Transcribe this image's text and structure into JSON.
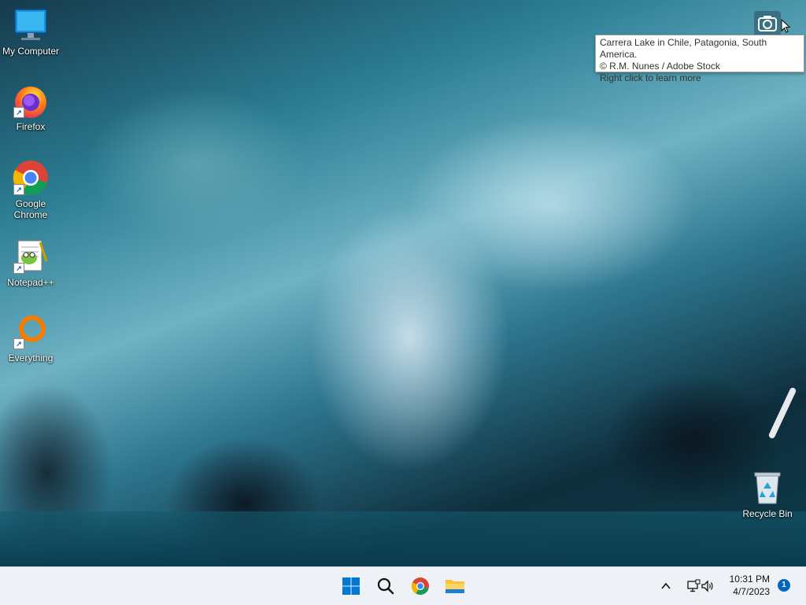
{
  "desktop": {
    "icons": [
      {
        "label": "My Computer",
        "icon": "monitor-icon"
      },
      {
        "label": "Firefox",
        "icon": "firefox-icon"
      },
      {
        "label": "Google\nChrome",
        "icon": "chrome-icon"
      },
      {
        "label": "Notepad++",
        "icon": "notepadpp-icon"
      },
      {
        "label": "Everything",
        "icon": "everything-icon"
      },
      {
        "label": "Recycle Bin",
        "icon": "recycle-bin-icon"
      }
    ],
    "shortcut_arrow": "↗"
  },
  "spotlight": {
    "tooltip_line1": "Carrera Lake in Chile, Patagonia, South America.",
    "tooltip_line2": "© R.M. Nunes / Adobe Stock",
    "tooltip_line3": "Right click to learn more",
    "icon": "camera-icon"
  },
  "taskbar": {
    "buttons": [
      "start-icon",
      "search-icon",
      "chrome-icon",
      "file-explorer-icon"
    ],
    "tray": {
      "icons": [
        "chevron-up-icon",
        "network-icon",
        "volume-icon"
      ],
      "time": "10:31 PM",
      "date": "4/7/2023",
      "notification_count": "1"
    }
  },
  "colors": {
    "taskbar_bg": "#eef1f5",
    "accent": "#0067c0"
  }
}
